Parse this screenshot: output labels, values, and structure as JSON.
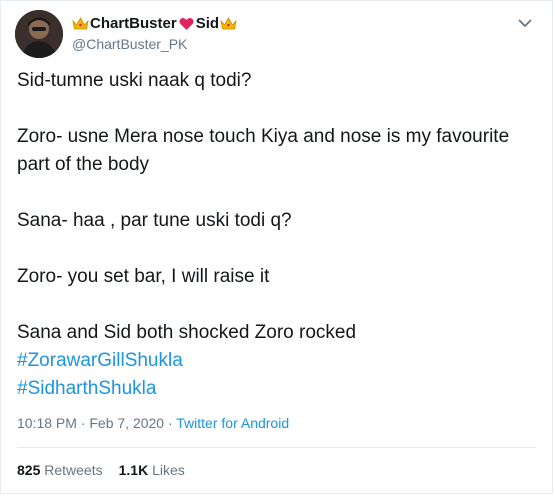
{
  "tweet": {
    "display_name_part1": "ChartBuster",
    "display_name_part2": "Sid",
    "handle": "@ChartBuster_PK",
    "lines": [
      "Sid-tumne uski naak q todi?",
      "Zoro- usne Mera nose touch Kiya and nose is my favourite part of the body",
      "Sana- haa , par tune uski todi q?",
      "Zoro- you set bar, I will raise it",
      "Sana and Sid both shocked Zoro rocked"
    ],
    "hashtags": [
      "#ZorawarGillShukla",
      "#SidharthShukla"
    ],
    "timestamp": "10:18 PM · Feb 7, 2020 · ",
    "source": "Twitter for Android",
    "retweets_count": "825",
    "retweets_label": "Retweets",
    "likes_count": "1.1K",
    "likes_label": "Likes"
  },
  "icons": {
    "crown": "crown-emoji-icon",
    "heart": "red-heart-emoji-icon",
    "menu": "chevron-down-icon"
  },
  "colors": {
    "link": "#1b95e0",
    "secondary_text": "#657786",
    "heart": "#e0245e",
    "crown": "#f5b50a"
  }
}
